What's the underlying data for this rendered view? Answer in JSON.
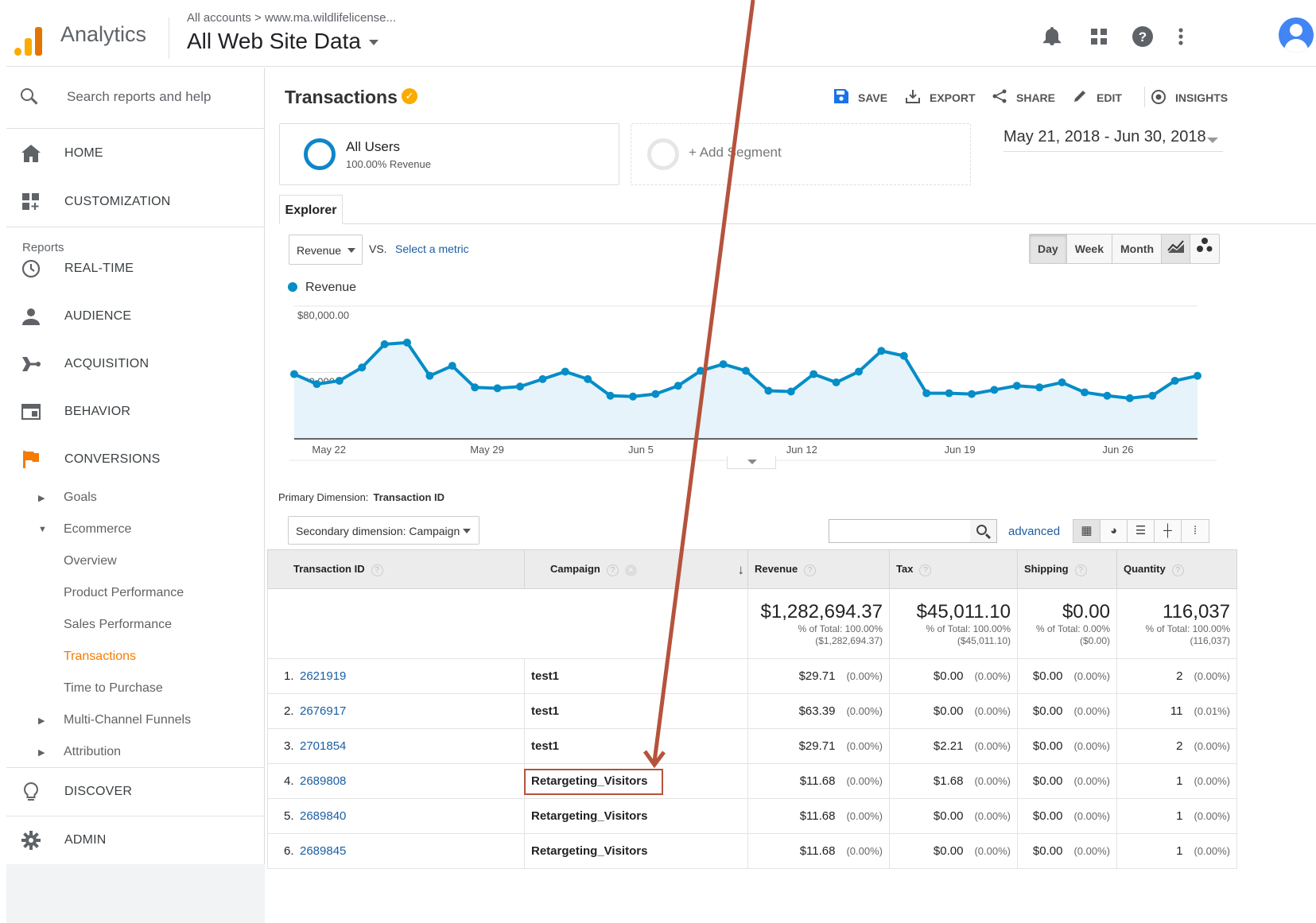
{
  "header": {
    "app_name": "Analytics",
    "breadcrumb": "All accounts > www.ma.wildlifelicense...",
    "property_view": "All Web Site Data",
    "icons": [
      "bell-icon",
      "apps-grid-icon",
      "help-icon",
      "more-vert-icon",
      "account-avatar"
    ]
  },
  "sidebar": {
    "search_placeholder": "Search reports and help",
    "top_items": [
      {
        "label": "HOME",
        "icon": "home-icon"
      },
      {
        "label": "CUSTOMIZATION",
        "icon": "customization-icon"
      }
    ],
    "reports_heading": "Reports",
    "report_items": [
      {
        "label": "REAL-TIME",
        "icon": "clock-icon"
      },
      {
        "label": "AUDIENCE",
        "icon": "person-icon"
      },
      {
        "label": "ACQUISITION",
        "icon": "acquisition-icon"
      },
      {
        "label": "BEHAVIOR",
        "icon": "behavior-icon"
      },
      {
        "label": "CONVERSIONS",
        "icon": "flag-icon"
      }
    ],
    "conversions_sub": [
      {
        "label": "Goals"
      },
      {
        "label": "Ecommerce"
      },
      {
        "label": "Overview"
      },
      {
        "label": "Product Performance"
      },
      {
        "label": "Sales Performance"
      },
      {
        "label": "Transactions",
        "active": true
      },
      {
        "label": "Time to Purchase"
      },
      {
        "label": "Multi-Channel Funnels"
      },
      {
        "label": "Attribution"
      }
    ],
    "bottom_items": [
      {
        "label": "DISCOVER",
        "icon": "lightbulb-icon"
      },
      {
        "label": "ADMIN",
        "icon": "gear-icon"
      }
    ]
  },
  "report": {
    "title": "Transactions",
    "toolbar": {
      "save": "SAVE",
      "export": "EXPORT",
      "share": "SHARE",
      "edit": "EDIT",
      "insights": "INSIGHTS"
    },
    "segment": {
      "name": "All Users",
      "sub": "100.00% Revenue",
      "add_label": "+ Add Segment"
    },
    "date_range": "May 21, 2018 - Jun 30, 2018",
    "tab": "Explorer",
    "metric_select": "Revenue",
    "vs_label": "VS.",
    "select_metric": "Select a metric",
    "granularity": {
      "day": "Day",
      "week": "Week",
      "month": "Month",
      "selected": "Day"
    },
    "legend_label": "Revenue",
    "primary_dimension_label": "Primary Dimension:",
    "primary_dimension_value": "Transaction ID",
    "secondary_dimension": "Secondary dimension: Campaign",
    "advanced_label": "advanced"
  },
  "chart_data": {
    "type": "area",
    "series": [
      {
        "name": "Revenue",
        "color": "#058dc7"
      }
    ],
    "x_tick_labels": [
      "May 22",
      "May 29",
      "Jun 5",
      "Jun 12",
      "Jun 19",
      "Jun 26"
    ],
    "x": [
      "May 21",
      "May 22",
      "May 23",
      "May 24",
      "May 25",
      "May 26",
      "May 27",
      "May 28",
      "May 29",
      "May 30",
      "May 31",
      "Jun 1",
      "Jun 2",
      "Jun 3",
      "Jun 4",
      "Jun 5",
      "Jun 6",
      "Jun 7",
      "Jun 8",
      "Jun 9",
      "Jun 10",
      "Jun 11",
      "Jun 12",
      "Jun 13",
      "Jun 14",
      "Jun 15",
      "Jun 16",
      "Jun 17",
      "Jun 18",
      "Jun 19",
      "Jun 20",
      "Jun 21",
      "Jun 22",
      "Jun 23",
      "Jun 24",
      "Jun 25",
      "Jun 26",
      "Jun 27",
      "Jun 28",
      "Jun 29",
      "Jun 30"
    ],
    "values": [
      39000,
      33000,
      35000,
      43000,
      57000,
      58000,
      38000,
      44000,
      31000,
      30500,
      31500,
      36000,
      40500,
      36000,
      26000,
      25500,
      27000,
      32000,
      41000,
      45000,
      41000,
      29000,
      28500,
      39000,
      34000,
      40500,
      53000,
      50000,
      27500,
      27500,
      27000,
      29500,
      32000,
      31000,
      34000,
      28000,
      26000,
      24500,
      26000,
      35000,
      38000
    ],
    "y_tick_labels": [
      "$80,000.00",
      "$40,000.00"
    ],
    "ylim": [
      0,
      80000
    ],
    "grid": true
  },
  "table": {
    "headers": {
      "transaction_id": "Transaction ID",
      "campaign": "Campaign",
      "revenue": "Revenue",
      "tax": "Tax",
      "shipping": "Shipping",
      "quantity": "Quantity"
    },
    "totals": {
      "revenue": "$1,282,694.37",
      "revenue_pct": "% of Total: 100.00%",
      "revenue_abs": "($1,282,694.37)",
      "tax": "$45,011.10",
      "tax_pct": "% of Total: 100.00%",
      "tax_abs": "($45,011.10)",
      "shipping": "$0.00",
      "shipping_pct": "% of Total: 0.00%",
      "shipping_abs": "($0.00)",
      "quantity": "116,037",
      "quantity_pct": "% of Total: 100.00%",
      "quantity_abs": "(116,037)"
    },
    "rows": [
      {
        "num": "1.",
        "id": "2621919",
        "campaign": "test1",
        "revenue": "$29.71",
        "revenue_pct": "(0.00%)",
        "tax": "$0.00",
        "tax_pct": "(0.00%)",
        "shipping": "$0.00",
        "shipping_pct": "(0.00%)",
        "quantity": "2",
        "quantity_pct": "(0.00%)"
      },
      {
        "num": "2.",
        "id": "2676917",
        "campaign": "test1",
        "revenue": "$63.39",
        "revenue_pct": "(0.00%)",
        "tax": "$0.00",
        "tax_pct": "(0.00%)",
        "shipping": "$0.00",
        "shipping_pct": "(0.00%)",
        "quantity": "11",
        "quantity_pct": "(0.01%)"
      },
      {
        "num": "3.",
        "id": "2701854",
        "campaign": "test1",
        "revenue": "$29.71",
        "revenue_pct": "(0.00%)",
        "tax": "$2.21",
        "tax_pct": "(0.00%)",
        "shipping": "$0.00",
        "shipping_pct": "(0.00%)",
        "quantity": "2",
        "quantity_pct": "(0.00%)"
      },
      {
        "num": "4.",
        "id": "2689808",
        "campaign": "Retargeting_Visitors",
        "revenue": "$11.68",
        "revenue_pct": "(0.00%)",
        "tax": "$1.68",
        "tax_pct": "(0.00%)",
        "shipping": "$0.00",
        "shipping_pct": "(0.00%)",
        "quantity": "1",
        "quantity_pct": "(0.00%)"
      },
      {
        "num": "5.",
        "id": "2689840",
        "campaign": "Retargeting_Visitors",
        "revenue": "$11.68",
        "revenue_pct": "(0.00%)",
        "tax": "$0.00",
        "tax_pct": "(0.00%)",
        "shipping": "$0.00",
        "shipping_pct": "(0.00%)",
        "quantity": "1",
        "quantity_pct": "(0.00%)"
      },
      {
        "num": "6.",
        "id": "2689845",
        "campaign": "Retargeting_Visitors",
        "revenue": "$11.68",
        "revenue_pct": "(0.00%)",
        "tax": "$0.00",
        "tax_pct": "(0.00%)",
        "shipping": "$0.00",
        "shipping_pct": "(0.00%)",
        "quantity": "1",
        "quantity_pct": "(0.00%)"
      }
    ]
  },
  "annotation": {
    "highlight_color": "#b5533c",
    "arrow_color": "#b5533c"
  }
}
